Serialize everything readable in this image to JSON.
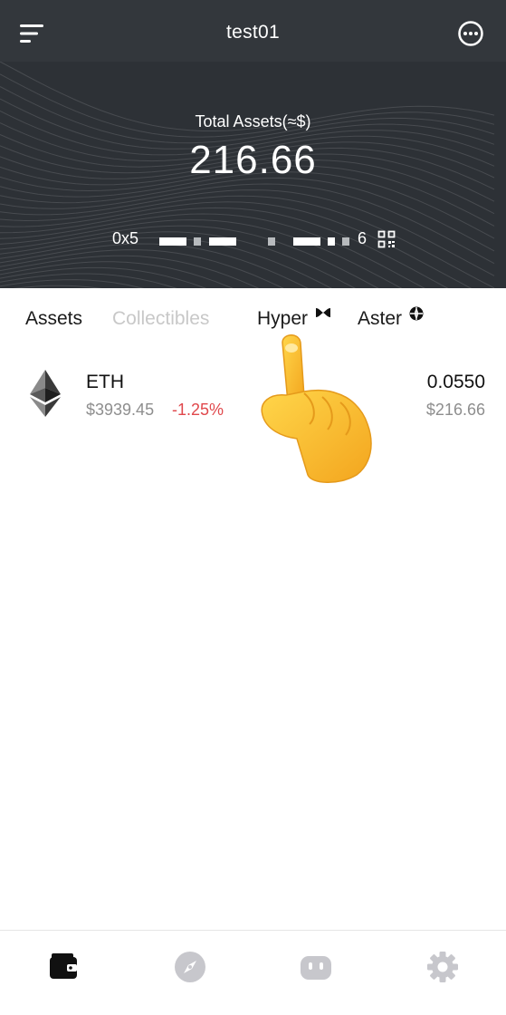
{
  "header": {
    "wallet_name": "test01",
    "total_label": "Total Assets(≈$)",
    "total_value": "216.66",
    "address_prefix": "0x5",
    "address_suffix": "6"
  },
  "tabs": [
    {
      "label": "Assets",
      "active": true
    },
    {
      "label": "Collectibles",
      "active": false
    },
    {
      "label": "Hyper",
      "active": false
    },
    {
      "label": "Aster",
      "active": false
    }
  ],
  "assets": [
    {
      "symbol": "ETH",
      "price": "$3939.45",
      "change": "-1.25%",
      "amount": "0.0550",
      "value": "$216.66",
      "icon": "ethereum-icon"
    }
  ],
  "bottom_nav": [
    {
      "name": "wallet",
      "icon": "wallet-icon",
      "active": true
    },
    {
      "name": "discover",
      "icon": "compass-icon",
      "active": false
    },
    {
      "name": "apps",
      "icon": "robot-icon",
      "active": false
    },
    {
      "name": "settings",
      "icon": "gear-icon",
      "active": false
    }
  ],
  "colors": {
    "header_bg": "#2d3136",
    "negative": "#e0484c",
    "muted_text": "#8e8e8e",
    "nav_inactive": "#c7c7cc"
  }
}
